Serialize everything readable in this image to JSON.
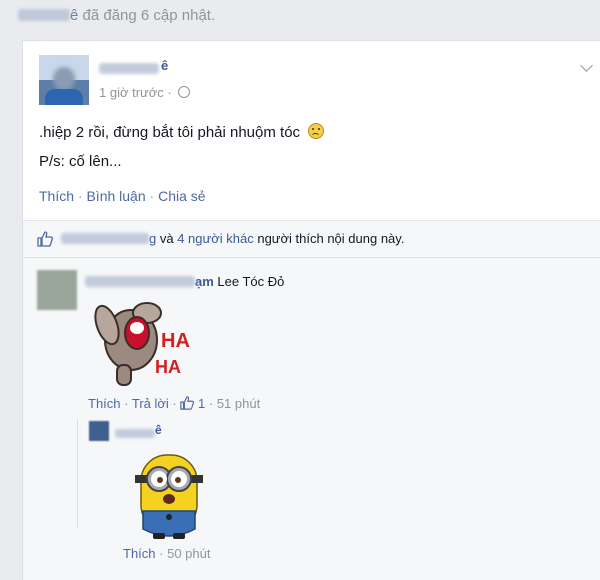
{
  "header": {
    "name_suffix": "ê",
    "action_text": "đã đăng 6 cập nhật."
  },
  "post": {
    "author_suffix": "ê",
    "time": "1 giờ trước",
    "line1": ".hiệp 2 rồi, đừng bắt tôi phải nhuộm tóc",
    "line2": "P/s: cố lên...",
    "actions": {
      "like": "Thích",
      "comment": "Bình luận",
      "share": "Chia sẻ",
      "separator": "·"
    }
  },
  "likes": {
    "name_suffix": "g",
    "connector": "và",
    "others": "4 người khác",
    "suffix": "người thích nội dung này."
  },
  "comments": [
    {
      "name_suffix": "ạm",
      "text": "Lee Tóc Đỏ",
      "sticker_text": [
        "HA",
        "HA"
      ],
      "like": "Thích",
      "reply": "Trả lời",
      "like_count": "1",
      "time": "51 phút"
    },
    {
      "name_suffix": "ê",
      "like": "Thích",
      "time": "50 phút"
    }
  ],
  "icons": [
    "globe-icon",
    "chevron-down-icon",
    "thumbs-up-icon",
    "sad-emoji-icon"
  ],
  "colors": {
    "link": "#3b5998",
    "action": "#4e69a2",
    "muted": "#90949c",
    "panel": "#f6f7f9"
  }
}
